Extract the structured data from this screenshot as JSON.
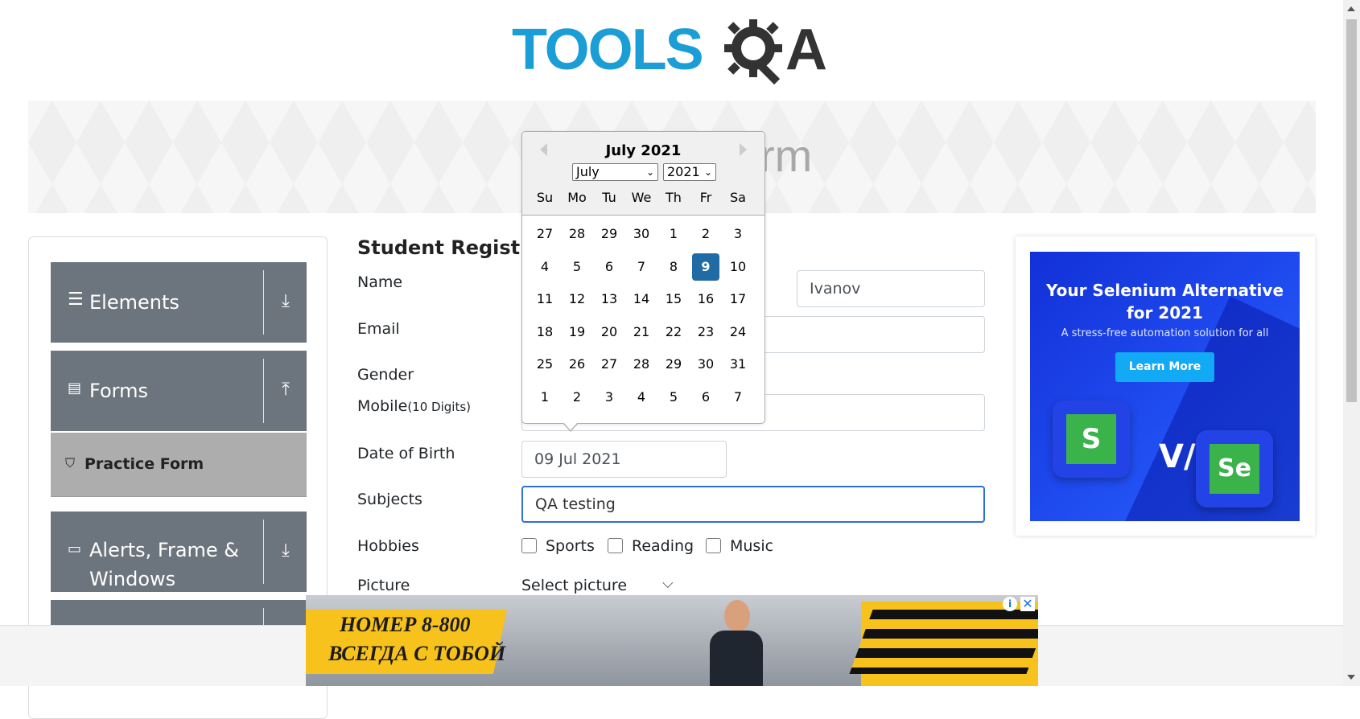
{
  "logo": {
    "text_left": "TOOLS",
    "text_right": "A"
  },
  "banner": {
    "title": "Practice Form"
  },
  "sidebar": {
    "groups": [
      {
        "label": "Elements",
        "icon": "menu-icon",
        "arrow": "download-icon"
      },
      {
        "label": "Forms",
        "icon": "document-icon",
        "arrow": "upload-icon"
      },
      {
        "label_line1": "Alerts, Frame &",
        "label_line2": "Windows",
        "icon": "window-icon",
        "arrow": "download-icon"
      }
    ],
    "sub_item": {
      "label": "Practice Form",
      "icon": "html5-icon"
    }
  },
  "form": {
    "title": "Student Registration Form",
    "labels": {
      "name": "Name",
      "email": "Email",
      "gender": "Gender",
      "mobile": "Mobile",
      "mobile_hint": "(10 Digits)",
      "dob": "Date of Birth",
      "subjects": "Subjects",
      "hobbies": "Hobbies",
      "picture": "Picture"
    },
    "last_name_value": "Ivanov",
    "dob_value": "09 Jul 2021",
    "subjects_value": "QA testing",
    "hobbies": [
      "Sports",
      "Reading",
      "Music"
    ],
    "picture_select": "Select picture"
  },
  "datepicker": {
    "month_title": "July 2021",
    "month_select": "July",
    "year_select": "2021",
    "day_names": [
      "Su",
      "Mo",
      "Tu",
      "We",
      "Th",
      "Fr",
      "Sa"
    ],
    "weeks": [
      [
        "27",
        "28",
        "29",
        "30",
        "1",
        "2",
        "3"
      ],
      [
        "4",
        "5",
        "6",
        "7",
        "8",
        "9",
        "10"
      ],
      [
        "11",
        "12",
        "13",
        "14",
        "15",
        "16",
        "17"
      ],
      [
        "18",
        "19",
        "20",
        "21",
        "22",
        "23",
        "24"
      ],
      [
        "25",
        "26",
        "27",
        "28",
        "29",
        "30",
        "31"
      ],
      [
        "1",
        "2",
        "3",
        "4",
        "5",
        "6",
        "7"
      ]
    ],
    "selected": "9",
    "selected_color": "#216ba5"
  },
  "right_ad": {
    "headline_line1": "Your Selenium Alternative",
    "headline_line2": "for 2021",
    "subtitle": "A stress-free automation solution for all",
    "button": "Learn More",
    "vs": "V/s",
    "left_tile": "S",
    "right_tile": "Se"
  },
  "bottom_ad": {
    "line1": "НОМЕР 8-800",
    "line2": "ВСЕГДА С ТОБОЙ",
    "close": "✕",
    "info": "i"
  },
  "colors": {
    "brand_blue": "#1b9ed6",
    "sidebar_group": "#6c757d",
    "sidebar_active": "#adadad",
    "focus_border": "#2d6fd6"
  }
}
